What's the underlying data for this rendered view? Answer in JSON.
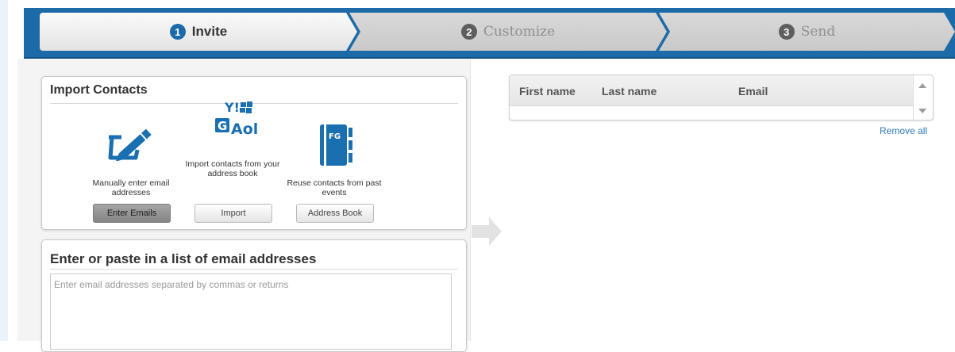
{
  "wizard": {
    "steps": [
      {
        "number": "1",
        "label": "Invite",
        "active": true
      },
      {
        "number": "2",
        "label": "Customize",
        "active": false
      },
      {
        "number": "3",
        "label": "Send",
        "active": false
      }
    ]
  },
  "import_contacts": {
    "title": "Import Contacts",
    "options": [
      {
        "icon": "pencil-edit-icon",
        "description": "Manually enter email addresses",
        "button": "Enter Emails",
        "selected": true
      },
      {
        "icon": "address-book-providers-icon",
        "description": "Import contacts from your address book",
        "button": "Import",
        "selected": false
      },
      {
        "icon": "fg-address-book-icon",
        "description": "Reuse contacts from past events",
        "button": "Address Book",
        "selected": false
      }
    ],
    "provider_logos": {
      "aol": "Aol",
      "google": "G",
      "yahoo": "Y!",
      "fg": "FG"
    }
  },
  "paste_list": {
    "title": "Enter or paste in a list of email addresses",
    "placeholder": "Enter email addresses separated by commas or returns",
    "value": ""
  },
  "contacts_table": {
    "columns": [
      "First name",
      "Last name",
      "Email"
    ],
    "rows": [],
    "remove_all_label": "Remove all"
  },
  "colors": {
    "header_blue": "#1c6aa8",
    "active_step_bg": "#f0f0f0",
    "inactive_step_bg": "#d0d0d0",
    "link_blue": "#2a7ab8",
    "icon_blue": "#1a6fb0"
  }
}
